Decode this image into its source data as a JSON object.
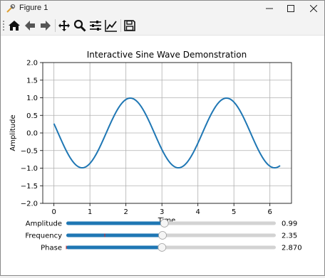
{
  "window": {
    "title": "Figure 1",
    "minimize_symbol": "—",
    "restore_icon": "square-icon",
    "close_symbol": "✕"
  },
  "toolbar": {
    "icons": [
      "home-icon",
      "back-arrow-icon",
      "forward-arrow-icon",
      "pan-icon",
      "zoom-icon",
      "configure-subplots-icon",
      "edit-axes-icon",
      "save-icon"
    ]
  },
  "chart_data": {
    "type": "line",
    "title": "Interactive Sine Wave Demonstration",
    "xlabel": "Time",
    "ylabel": "Amplitude",
    "xlim": [
      -0.31,
      6.6
    ],
    "ylim": [
      -2.0,
      2.0
    ],
    "xticks": [
      "0",
      "1",
      "2",
      "3",
      "4",
      "5",
      "6"
    ],
    "yticks": [
      "2.0",
      "1.5",
      "1.0",
      "0.5",
      "0.0",
      "−0.5",
      "−1.0",
      "−1.5",
      "−2.0"
    ],
    "grid": true,
    "series": [
      {
        "color": "#1f77b4",
        "function": "y = amplitude * sin(frequency * t + phase)",
        "x_range": [
          0,
          6.283
        ]
      }
    ]
  },
  "sliders": [
    {
      "label": "Amplitude",
      "value": 0.99,
      "display": "0.99",
      "min": 0.1,
      "max": 2.0,
      "init": 1.0
    },
    {
      "label": "Frequency",
      "value": 2.35,
      "display": "2.35",
      "min": 0.1,
      "max": 5.0,
      "init": 1.0
    },
    {
      "label": "Phase",
      "value": 2.87,
      "display": "2.870",
      "min": 0.0,
      "max": 6.283,
      "init": 0.0
    }
  ],
  "colors": {
    "slider_fill": "#1f77b4",
    "slider_track": "#d3d3d3",
    "init_marker": "#d62728",
    "grid": "#b0b0b0"
  }
}
